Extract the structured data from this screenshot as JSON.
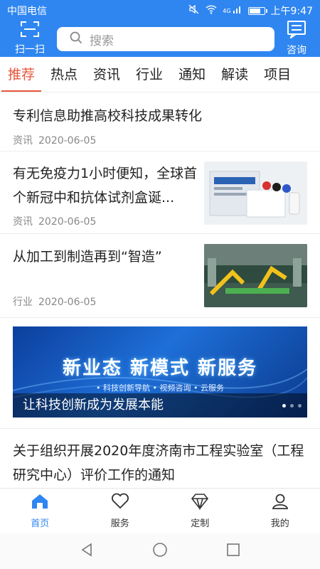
{
  "status_bar": {
    "carrier": "中国电信",
    "network": "4G",
    "time": "上午9:47"
  },
  "header": {
    "scan_label": "扫一扫",
    "search_placeholder": "搜索",
    "consult_label": "咨询"
  },
  "tabs": [
    {
      "label": "推荐",
      "active": true
    },
    {
      "label": "热点"
    },
    {
      "label": "资讯"
    },
    {
      "label": "行业"
    },
    {
      "label": "通知"
    },
    {
      "label": "解读"
    },
    {
      "label": "项目"
    }
  ],
  "feed": [
    {
      "title": "专利信息助推高校科技成果转化",
      "category": "资讯",
      "date": "2020-06-05"
    },
    {
      "title": "有无免疫力1小时便知，全球首个新冠中和抗体试剂盒诞...",
      "category": "资讯",
      "date": "2020-06-05",
      "thumbnail": "antibody-kit-image"
    },
    {
      "title": "从加工到制造再到“智造”",
      "category": "行业",
      "date": "2020-06-05",
      "thumbnail": "factory-robots-image"
    },
    {
      "banner": {
        "headline": "新业态  新模式  新服务",
        "subline": "• 科技创新导航   • 视频咨询   • 云服务",
        "caption": "让科技创新成为发展本能"
      }
    },
    {
      "title": "关于组织开展2020年度济南市工程实验室（工程研究中心）评价工作的通知"
    }
  ],
  "bottom_nav": [
    {
      "label": "首页",
      "icon": "home-icon",
      "active": true
    },
    {
      "label": "服务",
      "icon": "heart-icon"
    },
    {
      "label": "定制",
      "icon": "diamond-icon"
    },
    {
      "label": "我的",
      "icon": "user-icon"
    }
  ],
  "colors": {
    "brand_blue": "#2f86f0",
    "active_tab": "#e8563b"
  }
}
